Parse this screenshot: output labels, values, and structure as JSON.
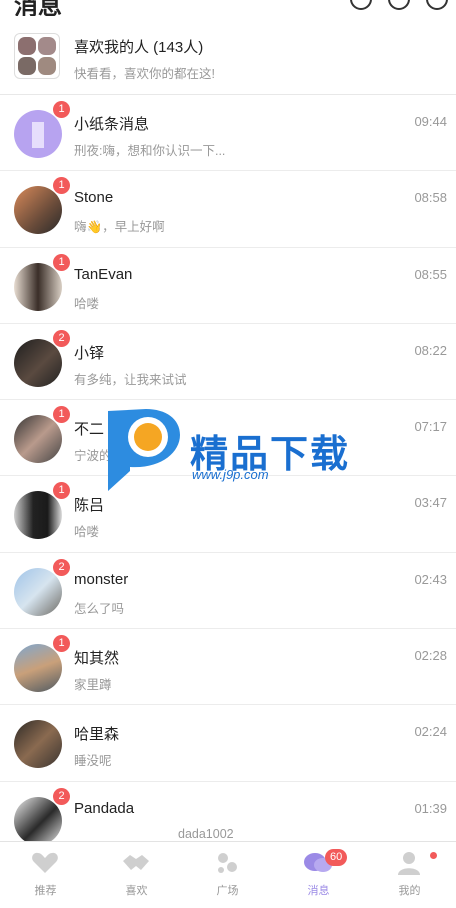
{
  "header": {
    "title": "消息"
  },
  "likes": {
    "title": "喜欢我的人 (143人)",
    "subtitle": "快看看，喜欢你的都在这!"
  },
  "messages": [
    {
      "name": "小纸条消息",
      "preview": "刑夜:嗨，想和你认识一下...",
      "time": "09:44",
      "badge": "1"
    },
    {
      "name": "Stone",
      "preview": "嗨👋，早上好啊",
      "time": "08:58",
      "badge": "1"
    },
    {
      "name": "TanEvan",
      "preview": "哈喽",
      "time": "08:55",
      "badge": "1"
    },
    {
      "name": "小铎",
      "preview": "有多纯，让我来试试",
      "time": "08:22",
      "badge": "2"
    },
    {
      "name": "不二",
      "preview": "宁波的",
      "time": "07:17",
      "badge": "1"
    },
    {
      "name": "陈吕",
      "preview": "哈喽",
      "time": "03:47",
      "badge": "1"
    },
    {
      "name": "monster",
      "preview": "怎么了吗",
      "time": "02:43",
      "badge": "2"
    },
    {
      "name": "知其然",
      "preview": "家里蹲",
      "time": "02:28",
      "badge": "1"
    },
    {
      "name": "哈里森",
      "preview": "睡没呢",
      "time": "02:24",
      "badge": ""
    },
    {
      "name": "Pandada",
      "preview": "dada1002",
      "time": "01:39",
      "badge": "2"
    }
  ],
  "watermark": {
    "title": "精品下载",
    "url": "www.j9p.com"
  },
  "tabs": [
    {
      "label": "推荐",
      "icon": "hearts-icon"
    },
    {
      "label": "喜欢",
      "icon": "handshake-icon"
    },
    {
      "label": "广场",
      "icon": "dots-icon"
    },
    {
      "label": "消息",
      "icon": "chat-bubbles-icon",
      "badge": "60"
    },
    {
      "label": "我的",
      "icon": "person-icon"
    }
  ],
  "colors": {
    "accent": "#9b8ae6",
    "badge": "#f25a5a",
    "watermark": "#1a6fd0"
  }
}
